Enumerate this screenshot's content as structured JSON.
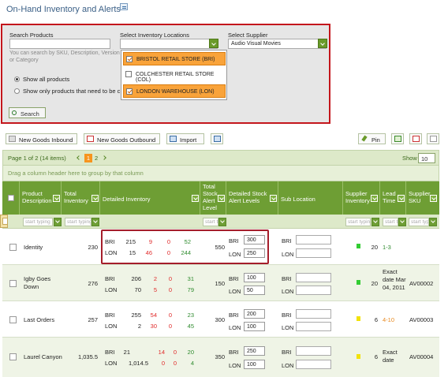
{
  "page": {
    "title": "On-Hand Inventory and Alerts",
    "title_icon": "report-icon"
  },
  "search": {
    "products_label": "Search Products",
    "products_value": "",
    "hint": "You can search by SKU, Description, Version or Category",
    "radio_all": "Show all products",
    "radio_some": "Show only products that need to be c",
    "locations_label": "Select Inventory Locations",
    "locations_value": "",
    "locations": [
      {
        "label": "BRISTOL RETAIL STORE (BRI)",
        "checked": true
      },
      {
        "label": "COLCHESTER RETAIL STORE (COL)",
        "checked": false
      },
      {
        "label": "LONDON WAREHOUSE (LON)",
        "checked": true
      }
    ],
    "supplier_label": "Select Supplier",
    "supplier_value": "Audio Visual Movies",
    "search_button": "Search"
  },
  "toolbar": {
    "inbound": "New Goods Inbound",
    "outbound": "New Goods Outbound",
    "import": "Import",
    "pin": "Pin"
  },
  "pager": {
    "info": "Page 1 of 2 (14 items)",
    "current": "1",
    "next": "2",
    "show_label": "Show",
    "show_value": "10"
  },
  "group_hint": "Drag a column header here to group by that column",
  "columns": [
    "Product Description",
    "Total Inventory",
    "Detailed Inventory",
    "Total Stock Alert Level",
    "Detailed Stock Alert Levels",
    "Sub Location",
    "Supplier Inventory",
    "Lead Time",
    "Supplier SKU"
  ],
  "filter_placeholder": "start typing",
  "filter_placeholder_short": "start t",
  "colors": {
    "header": "#6e9e34",
    "highlight": "#a51e2b",
    "accent": "#f7941d"
  },
  "rows": [
    {
      "name": "Identity",
      "total": "230",
      "bri": [
        "BRI",
        "215",
        "9",
        "0",
        "52"
      ],
      "lon": [
        "LON",
        "15",
        "46",
        "0",
        "244"
      ],
      "alert_total": "550",
      "alert_bri": "300",
      "alert_lon": "250",
      "sub_bri": "BRI",
      "sub_lon": "LON",
      "supplier_inv": "20",
      "stock_color": "#33cc33",
      "lead": "1-3",
      "sku": ""
    },
    {
      "name": "Igby Goes Down",
      "total": "276",
      "bri": [
        "BRI",
        "206",
        "2",
        "0",
        "31"
      ],
      "lon": [
        "LON",
        "70",
        "5",
        "0",
        "79"
      ],
      "alert_total": "150",
      "alert_bri": "100",
      "alert_lon": "50",
      "sub_bri": "BRI",
      "sub_lon": "LON",
      "supplier_inv": "20",
      "stock_color": "#33cc33",
      "lead": "Exact date Mar 04, 2011",
      "sku": "AV00002"
    },
    {
      "name": "Last Orders",
      "total": "257",
      "bri": [
        "BRI",
        "255",
        "54",
        "0",
        "23"
      ],
      "lon": [
        "LON",
        "2",
        "30",
        "0",
        "45"
      ],
      "alert_total": "300",
      "alert_bri": "200",
      "alert_lon": "100",
      "sub_bri": "BRI",
      "sub_lon": "LON",
      "supplier_inv": "6",
      "stock_color": "#f2e20a",
      "lead": "4-10",
      "sku": "AV00003"
    },
    {
      "name": "Laurel Canyon",
      "total": "1,035.5",
      "bri": [
        "BRI",
        "21",
        "14",
        "0",
        "20"
      ],
      "lon": [
        "LON",
        "1,014.5",
        "0",
        "0",
        "4"
      ],
      "alert_total": "350",
      "alert_bri": "250",
      "alert_lon": "100",
      "sub_bri": "BRI",
      "sub_lon": "LON",
      "supplier_inv": "6",
      "stock_color": "#f2e20a",
      "lead": "Exact date",
      "sku": "AV00004"
    }
  ]
}
